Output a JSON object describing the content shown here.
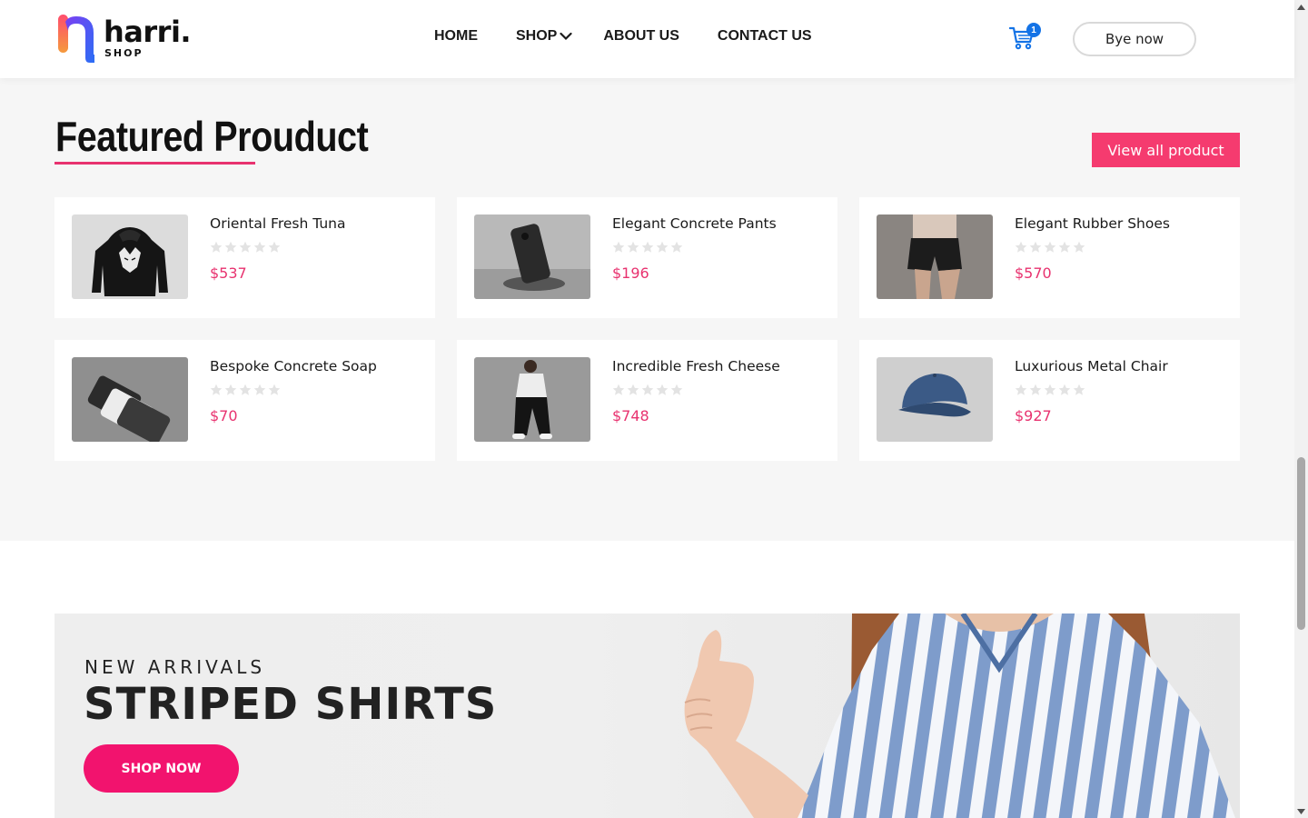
{
  "header": {
    "logo_word": "harri.",
    "logo_sub": "SHOP",
    "nav": [
      "HOME",
      "SHOP",
      "ABOUT US",
      "CONTACT US"
    ],
    "cart_count": "1",
    "cart_icon": "cart-icon",
    "buy_label": "Bye now"
  },
  "featured": {
    "title": "Featured Prouduct",
    "view_all": "View all product",
    "products": [
      {
        "name": "Oriental Fresh Tuna",
        "price": "$537",
        "rating": 0,
        "image": "black-wolf-hoodie"
      },
      {
        "name": "Elegant Concrete Pants",
        "price": "$196",
        "rating": 0,
        "image": "phone-on-wireless-charger"
      },
      {
        "name": "Elegant Rubber Shoes",
        "price": "$570",
        "rating": 0,
        "image": "black-shorts-model"
      },
      {
        "name": "Bespoke Concrete Soap",
        "price": "$70",
        "rating": 0,
        "image": "stacked-phones"
      },
      {
        "name": "Incredible Fresh Cheese",
        "price": "$748",
        "rating": 0,
        "image": "woman-black-pants"
      },
      {
        "name": "Luxurious Metal Chair",
        "price": "$927",
        "rating": 0,
        "image": "blue-cap"
      }
    ]
  },
  "banner": {
    "kicker": "NEW ARRIVALS",
    "headline": "STRIPED SHIRTS",
    "cta": "SHOP NOW",
    "image": "woman-striped-shirt-thumbs-up"
  },
  "colors": {
    "accent": "#f2136e",
    "price": "#e8326f",
    "cart_badge": "#1473e6"
  }
}
